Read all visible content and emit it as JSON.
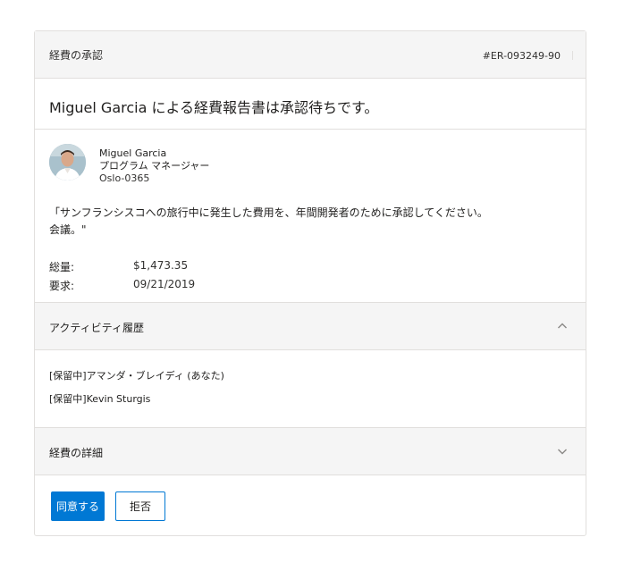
{
  "header": {
    "title": "経費の承認",
    "report_id": "#ER-093249-90"
  },
  "summary": {
    "text": "Miguel Garcia による経費報告書は承認待ちです。"
  },
  "requester": {
    "name": "Miguel Garcia",
    "role": "プログラム マネージャー",
    "location": "Oslo-0365"
  },
  "description": {
    "line1": "「サンフランシスコへの旅行中に発生した費用を、年間開発者のために承認してください。",
    "line2": "会議。\""
  },
  "details": {
    "total_label": "総量:",
    "total_value": "$1,473.35",
    "requested_label": "要求:",
    "requested_value": "09/21/2019"
  },
  "activity": {
    "title": "アクティビティ履歴",
    "items": [
      "[保留中]アマンダ・ブレイディ (あなた)",
      "[保留中]Kevin Sturgis"
    ]
  },
  "expense_details": {
    "title": "経費の詳細"
  },
  "actions": {
    "approve": "同意する",
    "reject": "拒否"
  },
  "colors": {
    "accent": "#0078d4",
    "header_bg": "#f5f5f5",
    "border": "#e1dfdd"
  },
  "icons": {
    "activity_toggle": "chevron-up-icon",
    "details_toggle": "chevron-down-icon"
  }
}
